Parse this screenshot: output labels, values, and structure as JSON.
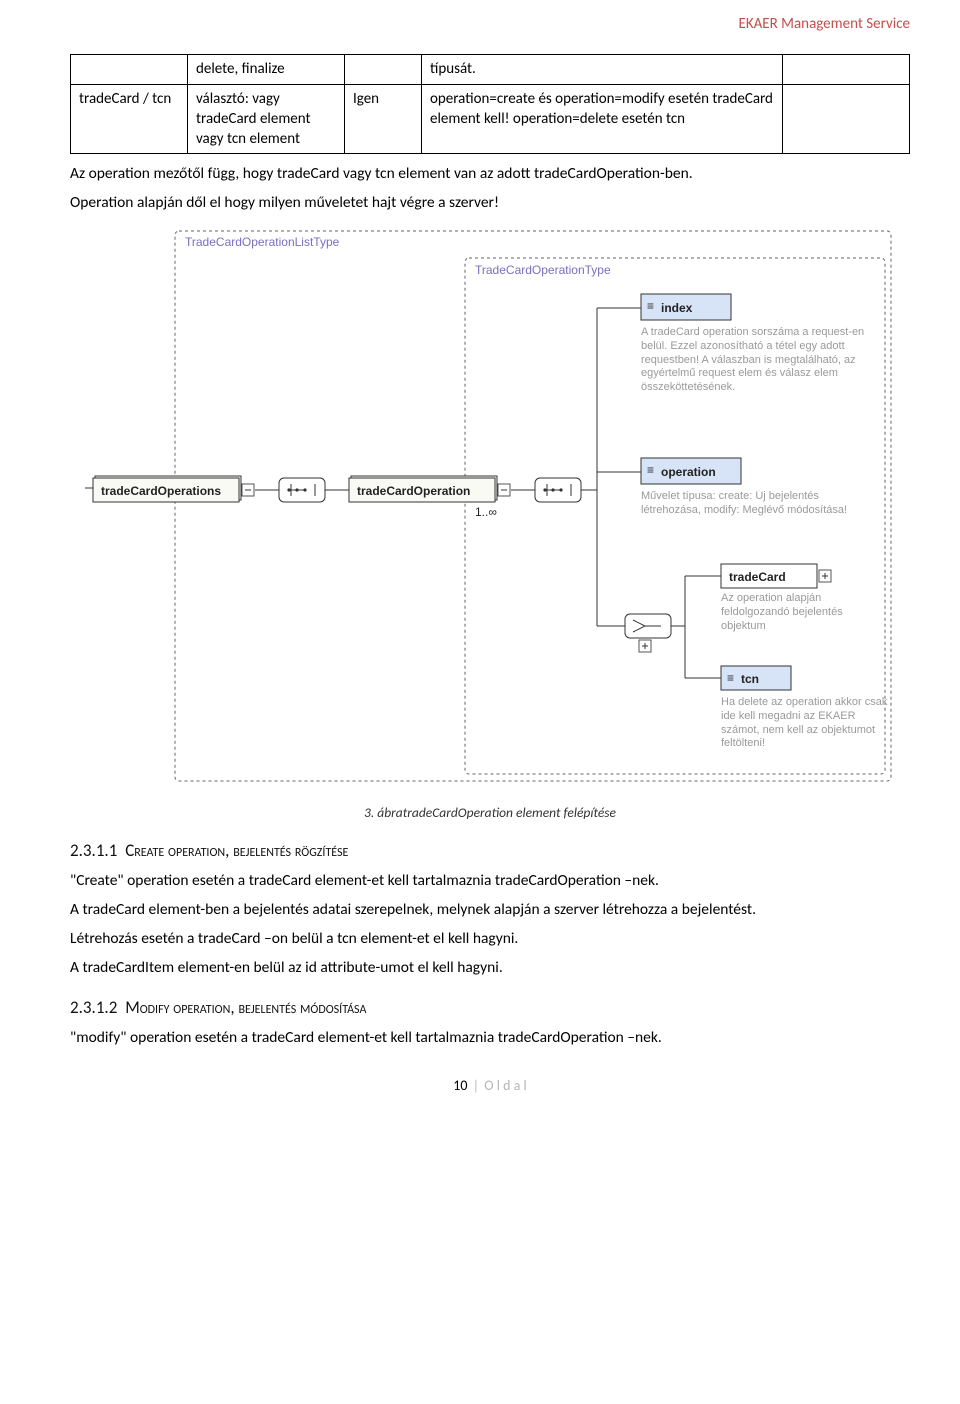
{
  "header": {
    "service": "EKAER Management Service"
  },
  "table": {
    "r0": {
      "c0": "",
      "c1": "delete, finalize",
      "c2": "",
      "c3": "típusát.",
      "c4": ""
    },
    "r1": {
      "c0": "tradeCard / tcn",
      "c1": "választó: vagy tradeCard element vagy tcn element",
      "c2": "Igen",
      "c3": "operation=create és operation=modify esetén tradeCard element kell! operation=delete esetén tcn",
      "c4": ""
    }
  },
  "para": {
    "p1": "Az operation mezőtől függ, hogy tradeCard vagy tcn element van az adott tradeCardOperation-ben.",
    "p2": "Operation alapján dől el hogy milyen műveletet hajt végre a szerver!",
    "caption": "3. ábratradeCardOperation element felépítése",
    "h1_num": "2.3.1.1",
    "h1_caps": "Create operation, bejelentés rögzítése",
    "p3": "\"Create\" operation esetén a tradeCard element-et kell tartalmaznia tradeCardOperation –nek.",
    "p4": "A tradeCard element-ben a bejelentés adatai szerepelnek, melynek alapján a szerver létrehozza a bejelentést.",
    "p5": "Létrehozás esetén a tradeCard –on belül a tcn element-et el kell hagyni.",
    "p6": "A tradeCardItem element-en belül az id attribute-umot el kell hagyni.",
    "h2_num": "2.3.1.2",
    "h2_caps": "Modify operation, bejelentés módosítása",
    "p7": "\"modify\" operation esetén a tradeCard element-et kell tartalmaznia tradeCardOperation –nek."
  },
  "diagram": {
    "outerLabel": "TradeCardOperationListType",
    "innerLabel": "TradeCardOperationType",
    "tco": "tradeCardOperations",
    "tc1": "tradeCardOperation",
    "mult": "1..∞",
    "idx": "index",
    "idx_desc": "A tradeCard operation sorszáma a request-en belül. Ezzel azonosítható a tétel egy adott requestben! A válaszban is megtalálható, az egyértelmű request elem és válasz elem összeköttetésének.",
    "op": "operation",
    "op_desc": "Művelet típusa: create: Új bejelentés létrehozása, modify: Meglévő módosítása!",
    "tcard": "tradeCard",
    "tcard_desc": "Az operation alapján feldolgozandó bejelentés objektum",
    "tcn": "tcn",
    "tcn_desc": "Ha delete az operation akkor csak ide kell megadni az EKAER számot, nem kell az objektumot feltölteni!"
  },
  "footer": {
    "page": "10",
    "sep": " | ",
    "label": "O l d a l"
  }
}
